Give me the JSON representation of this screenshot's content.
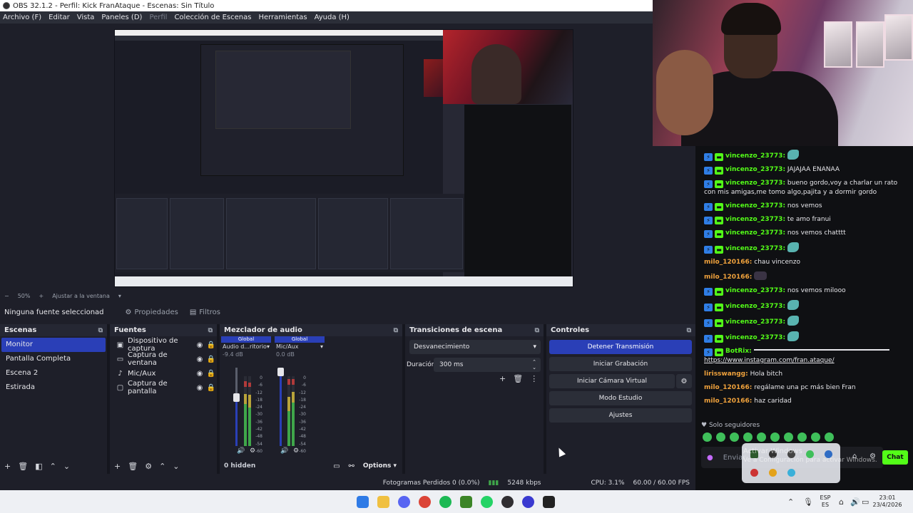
{
  "window": {
    "title": "OBS 32.1.2 - Perfil: Kick FranAtaque - Escenas: Sin Título"
  },
  "menu": [
    {
      "label": "Archivo (F)",
      "disabled": false
    },
    {
      "label": "Editar",
      "disabled": false
    },
    {
      "label": "Vista",
      "disabled": false
    },
    {
      "label": "Paneles (D)",
      "disabled": false
    },
    {
      "label": "Perfil",
      "disabled": true
    },
    {
      "label": "Colección de Escenas",
      "disabled": false
    },
    {
      "label": "Herramientas",
      "disabled": false
    },
    {
      "label": "Ayuda (H)",
      "disabled": false
    }
  ],
  "preview": {
    "zoom_label": "50%",
    "fit_label": "Ajustar a la ventana"
  },
  "source_toolbar": {
    "no_source": "Ninguna fuente seleccionad",
    "properties": "Propiedades",
    "filters": "Filtros"
  },
  "scenes": {
    "title": "Escenas",
    "items": [
      {
        "label": "Monitor",
        "selected": true
      },
      {
        "label": "Pantalla Completa",
        "selected": false
      },
      {
        "label": "Escena 2",
        "selected": false
      },
      {
        "label": "Estirada",
        "selected": false
      }
    ]
  },
  "sources": {
    "title": "Fuentes",
    "items": [
      {
        "label": "Dispositivo de captura",
        "icon": "camera-icon"
      },
      {
        "label": "Captura de ventana",
        "icon": "window-icon"
      },
      {
        "label": "Mic/Aux",
        "icon": "microphone-icon"
      },
      {
        "label": "Captura de pantalla",
        "icon": "monitor-icon"
      }
    ]
  },
  "mixer": {
    "title": "Mezclador de audio",
    "channels": [
      {
        "badge": "Global",
        "name": "Audio d...ritorio",
        "db": "-9.4 dB",
        "level": 0.62
      },
      {
        "badge": "Global",
        "name": "Mic/Aux",
        "db": "0.0 dB",
        "level": 0.95
      }
    ],
    "scale": [
      "0",
      "-6",
      "-12",
      "-18",
      "-24",
      "-30",
      "-36",
      "-42",
      "-48",
      "-54",
      "-60"
    ],
    "hidden_label": "0 hidden",
    "options_label": "Options"
  },
  "transitions": {
    "title": "Transiciones de escena",
    "selected": "Desvanecimiento",
    "duration_label": "Duración",
    "duration_value": "300 ms"
  },
  "controls": {
    "title": "Controles",
    "stop_stream": "Detener Transmisión",
    "start_record": "Iniciar Grabación",
    "start_virtualcam": "Iniciar Cámara Virtual",
    "studio_mode": "Modo Estudio",
    "settings": "Ajustes"
  },
  "status": {
    "dropped_frames": "Fotogramas Perdidos 0 (0.0%)",
    "bitrate": "5248 kbps",
    "cpu": "CPU: 3.1%",
    "fps": "60.00 / 60.00 FPS"
  },
  "chat": {
    "messages": [
      {
        "user": "vincenzo_23773:",
        "type": "sub",
        "text": "",
        "emote": "fish"
      },
      {
        "user": "vincenzo_23773:",
        "type": "sub",
        "text": "JAJAJAA ENANAA",
        "emote": ""
      },
      {
        "user": "vincenzo_23773:",
        "type": "sub",
        "text": "bueno gordo,voy a charlar un rato con mis amigas,me tomo algo,pajita y a dormir gordo",
        "emote": ""
      },
      {
        "user": "vincenzo_23773:",
        "type": "sub",
        "text": "nos vemos",
        "emote": ""
      },
      {
        "user": "vincenzo_23773:",
        "type": "sub",
        "text": "te amo franui",
        "emote": ""
      },
      {
        "user": "vincenzo_23773:",
        "type": "sub",
        "text": "nos vemos chatttt",
        "emote": ""
      },
      {
        "user": "vincenzo_23773:",
        "type": "sub",
        "text": "",
        "emote": "fish"
      },
      {
        "user": "milo_120166:",
        "type": "plain",
        "text": "chau vincenzo",
        "emote": ""
      },
      {
        "user": "milo_120166:",
        "type": "plain",
        "text": "",
        "emote": "ghost"
      },
      {
        "user": "vincenzo_23773:",
        "type": "sub",
        "text": "nos vemos milooo",
        "emote": ""
      },
      {
        "user": "vincenzo_23773:",
        "type": "sub",
        "text": "",
        "emote": "fish"
      },
      {
        "user": "vincenzo_23773:",
        "type": "sub",
        "text": "",
        "emote": "fish"
      },
      {
        "user": "vincenzo_23773:",
        "type": "sub",
        "text": "",
        "emote": "fish"
      },
      {
        "user": "BotRix:",
        "type": "bot",
        "text": "",
        "emote": "slider",
        "link": "https://www.instagram.com/fran.ataque/"
      },
      {
        "user": "lirisswangg:",
        "type": "plain",
        "text": "Hola bitch",
        "emote": ""
      },
      {
        "user": "milo_120166:",
        "type": "plain",
        "text": "regálame una pc más bien Fran",
        "emote": ""
      },
      {
        "user": "milo_120166:",
        "type": "plain",
        "text": "haz caridad",
        "emote": ""
      }
    ],
    "followers_only": "Solo seguidores",
    "input_placeholder": "Enviar",
    "send_label": "Chat",
    "watermark_line1": "Activar Windows",
    "watermark_line2": "Ve a Configuración para activar Windows."
  },
  "taskbar": {
    "lang_top": "ESP",
    "lang_bottom": "ES",
    "time": "23:01",
    "date": "23/4/2026"
  }
}
